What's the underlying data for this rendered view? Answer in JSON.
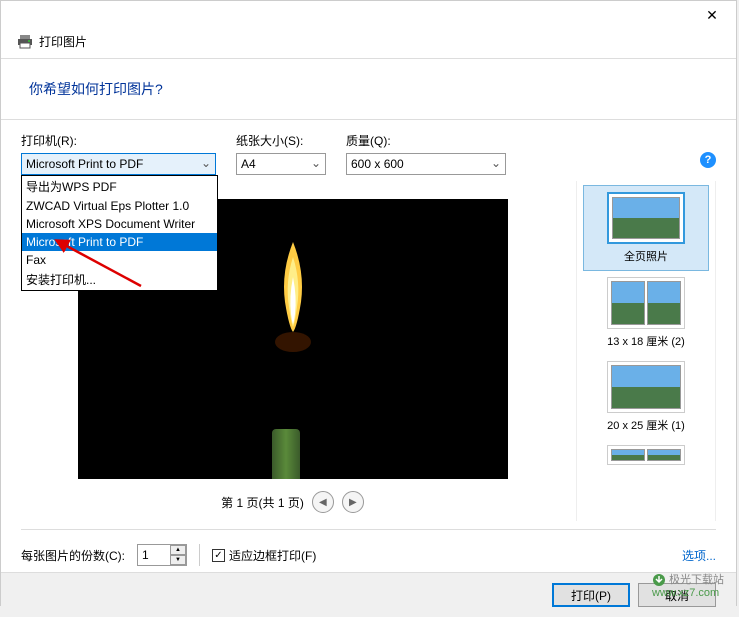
{
  "titlebar": {
    "close": "✕"
  },
  "header": {
    "title": "打印图片"
  },
  "banner": {
    "question": "你希望如何打印图片?"
  },
  "controls": {
    "printer_label": "打印机(R):",
    "paper_label": "纸张大小(S):",
    "quality_label": "质量(Q):",
    "printer_value": "Microsoft Print to PDF",
    "paper_value": "A4",
    "quality_value": "600 x 600",
    "printer_options": [
      "导出为WPS PDF",
      "ZWCAD Virtual Eps Plotter 1.0",
      "Microsoft XPS Document Writer",
      "Microsoft Print to PDF",
      "Fax",
      "安装打印机..."
    ],
    "selected_option_index": 3
  },
  "preview": {
    "page_info": "第 1 页(共 1 页)"
  },
  "layouts": [
    {
      "label": "全页照片",
      "type": "full",
      "selected": true
    },
    {
      "label": "13 x 18 厘米 (2)",
      "type": "half",
      "selected": false
    },
    {
      "label": "20 x 25 厘米 (1)",
      "type": "full",
      "selected": false
    }
  ],
  "bottom": {
    "copies_label": "每张图片的份数(C):",
    "copies_value": "1",
    "fit_label": "适应边框打印(F)",
    "fit_checked": true,
    "options_link": "选项..."
  },
  "buttons": {
    "print": "打印(P)",
    "cancel": "取消"
  },
  "watermark": {
    "brand": "极光下载站",
    "site": "www.xz7.com"
  }
}
